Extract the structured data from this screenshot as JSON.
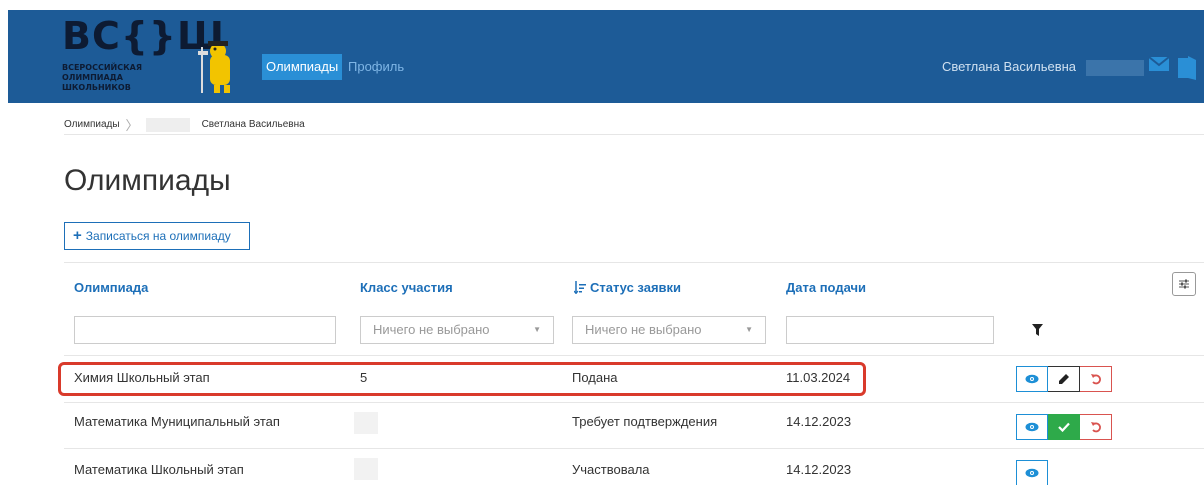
{
  "header": {
    "logo_big": "ВС{}Ш",
    "logo_lines": [
      "ВСЕРОССИЙСКАЯ",
      "ОЛИМПИАДА",
      "ШКОЛЬНИКОВ"
    ],
    "nav": [
      {
        "label": "Олимпиады",
        "active": true
      },
      {
        "label": "Профиль",
        "active": false
      }
    ],
    "user_name": "Светлана Васильевна",
    "icons": [
      "mail-icon",
      "exit-icon"
    ]
  },
  "breadcrumb": {
    "root": "Олимпиады",
    "current": "Светлана Васильевна"
  },
  "page_title": "Олимпиады",
  "add_button": "Записаться на олимпиаду",
  "table": {
    "columns": [
      {
        "label": "Олимпиада"
      },
      {
        "label": "Класс участия"
      },
      {
        "label": "Статус заявки",
        "icon": "sort-icon"
      },
      {
        "label": "Дата подачи"
      }
    ],
    "filters": {
      "olympiad": "",
      "class_placeholder": "Ничего не выбрано",
      "status_placeholder": "Ничего не выбрано",
      "date": ""
    },
    "rows": [
      {
        "olympiad": "Химия Школьный этап",
        "class": "5",
        "status": "Подана",
        "date": "11.03.2024",
        "actions": [
          "view",
          "edit",
          "undo"
        ],
        "highlighted": true
      },
      {
        "olympiad": "Математика Муниципальный этап",
        "class": "",
        "status": "Требует подтверждения",
        "date": "14.12.2023",
        "actions": [
          "view",
          "confirm",
          "undo"
        ],
        "highlighted": false
      },
      {
        "olympiad": "Математика Школьный этап",
        "class": "",
        "status": "Участвовала",
        "date": "14.12.2023",
        "actions": [
          "view"
        ],
        "highlighted": false
      }
    ]
  },
  "colors": {
    "header_bg": "#1d5b97",
    "accent": "#1d6fb8",
    "highlight": "#d93a2b",
    "confirm": "#2eaa4a",
    "undo": "#d9534f"
  }
}
